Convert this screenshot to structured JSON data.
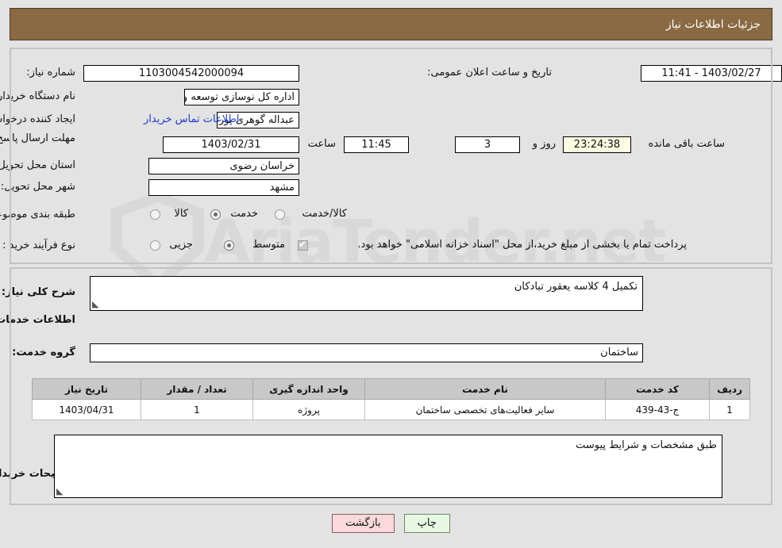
{
  "header": {
    "title": "جزئیات اطلاعات نیاز"
  },
  "watermark": {
    "text": "AriaTender.net"
  },
  "form": {
    "need_number_label": "شماره نیاز:",
    "need_number_value": "1103004542000094",
    "announce_datetime_label": "تاریخ و ساعت اعلان عمومی:",
    "announce_datetime_value": "1403/02/27 - 11:41",
    "buyer_org_label": "نام دستگاه خریدار:",
    "buyer_org_value": "اداره کل نوسازی  توسعه و تجهیز مدارس استان خراسان رضوی",
    "requester_label": "ایجاد کننده درخواست:",
    "requester_value": "عبداله گوهری پور کارشناس مسئول امور قراردادها  اداره کل نوسازی  توسعه و ت",
    "contact_link": "اطلاعات تماس خریدار",
    "deadline_label": "مهلت ارسال پاسخ: تا تاریخ:",
    "deadline_date": "1403/02/31",
    "deadline_hour_label": "ساعت",
    "deadline_hour": "11:45",
    "remaining_days": "3",
    "remaining_days_label": "روز و",
    "remaining_time": "23:24:38",
    "remaining_time_label": "ساعت باقی مانده",
    "province_label": "استان محل تحویل:",
    "province_value": "خراسان رضوی",
    "city_label": "شهر محل تحویل:",
    "city_value": "مشهد",
    "category_label": "طبقه بندی موضوعی:",
    "category_options": [
      {
        "label": "کالا",
        "selected": false
      },
      {
        "label": "خدمت",
        "selected": true
      },
      {
        "label": "کالا/خدمت",
        "selected": false
      }
    ],
    "process_label": "نوع فرآیند خرید :",
    "process_options": [
      {
        "label": "جزیی",
        "selected": false
      },
      {
        "label": "متوسط",
        "selected": true
      }
    ],
    "treasury_checkbox_checked": true,
    "treasury_text": "پرداخت تمام یا بخشی از مبلغ خرید،از محل \"اسناد خزانه اسلامی\" خواهد بود."
  },
  "description": {
    "need_desc_label": "شرح کلی نیاز:",
    "need_desc_value": "تکمیل 4 کلاسه یعقور تبادکان",
    "services_section_title": "اطلاعات خدمات مورد نیاز",
    "service_group_label": "گروه خدمت:",
    "service_group_value": "ساختمان"
  },
  "table": {
    "headers": [
      "ردیف",
      "کد خدمت",
      "نام خدمت",
      "واحد اندازه گیری",
      "تعداد / مقدار",
      "تاریخ نیاز"
    ],
    "rows": [
      {
        "row": "1",
        "code": "ج-43-439",
        "name": "سایر فعالیت‌های تخصصی ساختمان",
        "unit": "پروژه",
        "quantity": "1",
        "need_date": "1403/04/31"
      }
    ]
  },
  "buyer_notes": {
    "label": "توضیحات خریدار:",
    "value": "طبق مشخصات و شرایط پیوست"
  },
  "buttons": {
    "print": "چاپ",
    "back": "بازگشت"
  },
  "colors": {
    "header_brown": "#8a6a42",
    "link_blue": "#1a3ad6",
    "page_bg": "#e3e3e3",
    "print_btn": "#e8f7e4",
    "back_btn": "#f9d9db",
    "countdown_yellow": "#fbfbe0"
  }
}
